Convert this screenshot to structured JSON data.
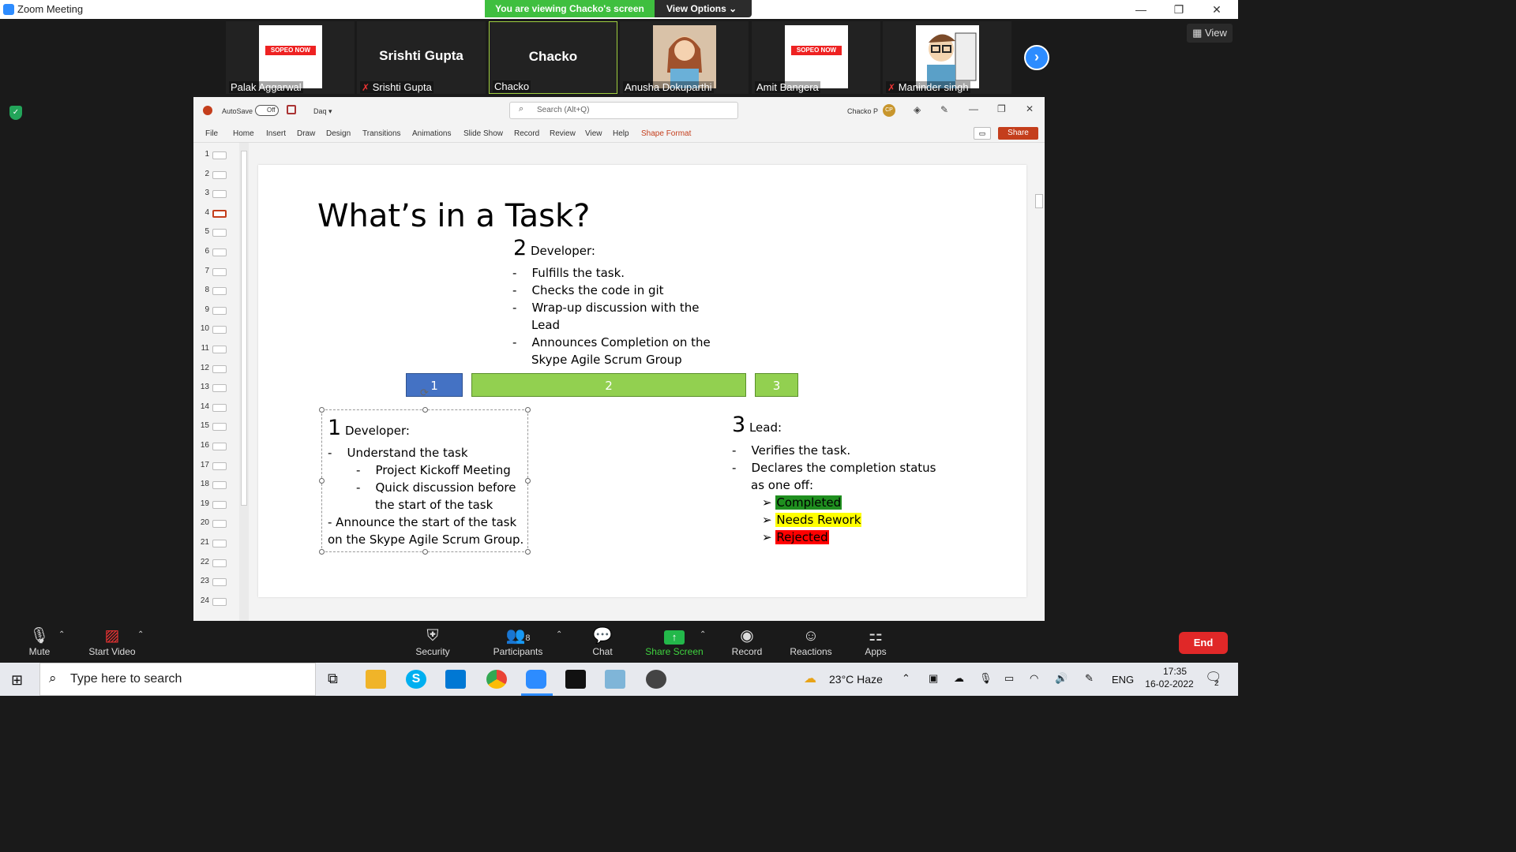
{
  "window": {
    "title": "Zoom Meeting"
  },
  "banner": {
    "viewing": "You are viewing Chacko's screen",
    "view_options": "View Options ⌄"
  },
  "participants": [
    {
      "name": "Palak Aggarwal",
      "logo": "SOPEO NOW"
    },
    {
      "name": "Srishti Gupta",
      "display": "Srishti Gupta",
      "muted": true
    },
    {
      "name": "Chacko",
      "display": "Chacko",
      "active": true
    },
    {
      "name": "Anusha Dokuparthi"
    },
    {
      "name": "Amit Bangera",
      "logo": "SOPEO NOW"
    },
    {
      "name": "Maninder singh",
      "muted": true
    }
  ],
  "view_button": "View",
  "ppt": {
    "autosave": "AutoSave",
    "toggle": "Off",
    "file_name": "Daq",
    "search_placeholder": "Search (Alt+Q)",
    "user": "Chacko P",
    "user_initials": "CP",
    "tabs": [
      "File",
      "Home",
      "Insert",
      "Draw",
      "Design",
      "Transitions",
      "Animations",
      "Slide Show",
      "Record",
      "Review",
      "View",
      "Help",
      "Shape Format"
    ],
    "share": "Share",
    "slides": [
      "1",
      "2",
      "3",
      "4",
      "5",
      "6",
      "7",
      "8",
      "9",
      "10",
      "11",
      "12",
      "13",
      "14",
      "15",
      "16",
      "17",
      "18",
      "19",
      "20",
      "21",
      "22",
      "23",
      "24"
    ],
    "selected_slide": "4"
  },
  "slide": {
    "title": "What’s in a Task?",
    "step2": {
      "num": "2",
      "role": "Developer:",
      "items": [
        "Fulfills the task.",
        "Checks the code in git",
        "Wrap-up discussion with the",
        "Lead",
        "Announces Completion on the",
        "Skype Agile Scrum Group"
      ]
    },
    "bars": [
      "1",
      "2",
      "3"
    ],
    "step1": {
      "num": "1",
      "role": "Developer:",
      "item1": "Understand the task",
      "sub1": "Project Kickoff Meeting",
      "sub2a": "Quick discussion before",
      "sub2b": "the start of the task",
      "item2a": "-  Announce the start of the task",
      "item2b": "on the Skype Agile Scrum Group."
    },
    "step3": {
      "num": "3",
      "role": "Lead:",
      "item1": "Verifies the task.",
      "item2a": "Declares the completion status",
      "item2b": "as one off:",
      "statuses": [
        "Completed",
        "Needs Rework",
        "Rejected"
      ]
    },
    "status_colors": [
      "#1f8f1f",
      "#ffff00",
      "#ff0000"
    ]
  },
  "toolbar": {
    "mute": "Mute",
    "video": "Start Video",
    "security": "Security",
    "participants": "Participants",
    "participant_count": "8",
    "chat": "Chat",
    "share": "Share Screen",
    "record": "Record",
    "reactions": "Reactions",
    "apps": "Apps",
    "end": "End"
  },
  "taskbar": {
    "search": "Type here to search",
    "weather": "23°C  Haze",
    "lang": "ENG",
    "time": "17:35",
    "date": "16-02-2022",
    "notif": "2"
  }
}
